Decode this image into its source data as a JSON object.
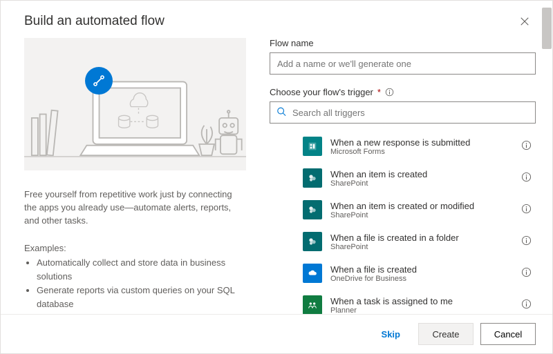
{
  "modal": {
    "title": "Build an automated flow",
    "close_label": "Close"
  },
  "left": {
    "description": "Free yourself from repetitive work just by connecting the apps you already use—automate alerts, reports, and other tasks.",
    "examples_label": "Examples:",
    "examples": [
      "Automatically collect and store data in business solutions",
      "Generate reports via custom queries on your SQL database"
    ]
  },
  "right": {
    "flow_name_label": "Flow name",
    "flow_name_placeholder": "Add a name or we'll generate one",
    "flow_name_value": "",
    "trigger_label": "Choose your flow's trigger",
    "search_placeholder": "Search all triggers",
    "search_value": ""
  },
  "triggers": [
    {
      "title": "When a new response is submitted",
      "subtitle": "Microsoft Forms",
      "color": "#038387",
      "icon": "forms"
    },
    {
      "title": "When an item is created",
      "subtitle": "SharePoint",
      "color": "#036c70",
      "icon": "sharepoint"
    },
    {
      "title": "When an item is created or modified",
      "subtitle": "SharePoint",
      "color": "#036c70",
      "icon": "sharepoint"
    },
    {
      "title": "When a file is created in a folder",
      "subtitle": "SharePoint",
      "color": "#036c70",
      "icon": "sharepoint"
    },
    {
      "title": "When a file is created",
      "subtitle": "OneDrive for Business",
      "color": "#0078d4",
      "icon": "onedrive"
    },
    {
      "title": "When a task is assigned to me",
      "subtitle": "Planner",
      "color": "#107c41",
      "icon": "planner"
    }
  ],
  "footer": {
    "skip": "Skip",
    "create": "Create",
    "cancel": "Cancel"
  },
  "icons": {
    "flow": "flow-icon",
    "search": "search-icon",
    "info": "info-icon"
  }
}
